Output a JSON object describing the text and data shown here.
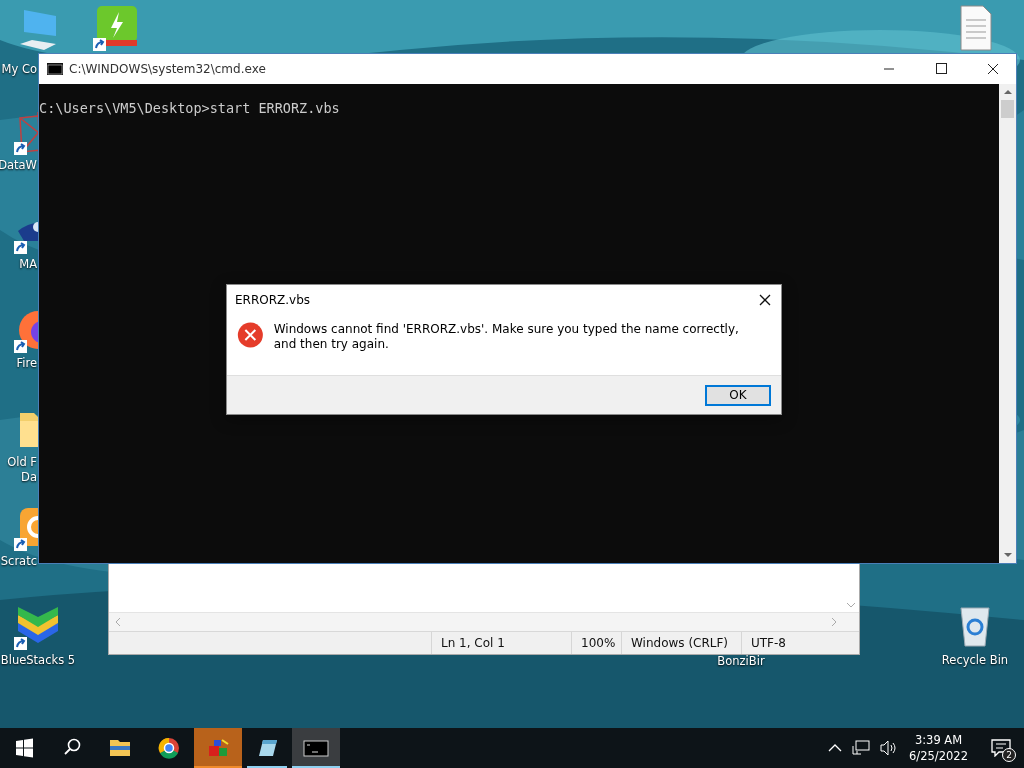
{
  "desktop_icons": [
    {
      "kind": "computer",
      "lines": [
        "My Co"
      ],
      "shortcut": false
    },
    {
      "kind": "green-app",
      "shortcut": true
    },
    {
      "kind": "network",
      "lines": [
        "DataW"
      ],
      "shortcut": true
    },
    {
      "kind": "ship",
      "lines": [
        "MA"
      ],
      "shortcut": true
    },
    {
      "kind": "firefox",
      "lines": [
        "Fire"
      ],
      "shortcut": true
    },
    {
      "kind": "folder",
      "lines": [
        "Old F",
        "Da"
      ],
      "shortcut": false
    },
    {
      "kind": "scratch",
      "lines": [
        "Scratc"
      ],
      "shortcut": true
    },
    {
      "kind": "bluestacks",
      "lines": [
        "BlueStacks 5"
      ],
      "shortcut": true
    },
    {
      "kind": "document",
      "shortcut": false
    },
    {
      "kind": "label-only",
      "lines": [
        "BonziBir"
      ]
    },
    {
      "kind": "recycle",
      "lines": [
        "Recycle Bin"
      ],
      "shortcut": false
    }
  ],
  "notepad": {
    "status": [
      "Ln 1, Col 1",
      "100%",
      "Windows (CRLF)",
      "UTF-8"
    ]
  },
  "cmd": {
    "title": "C:\\WINDOWS\\system32\\cmd.exe",
    "lines": [
      "C:\\Users\\VM5\\Desktop>start ERRORZ.vbs"
    ]
  },
  "dialog": {
    "title": "ERRORZ.vbs",
    "message": "Windows cannot find 'ERRORZ.vbs'. Make sure you typed the name correctly, and then try again.",
    "buttons": [
      "OK"
    ]
  },
  "taskbar": {
    "apps": [
      {
        "kind": "explorer",
        "running": false,
        "selected": false,
        "attention": false
      },
      {
        "kind": "chrome",
        "running": false,
        "selected": false,
        "attention": false
      },
      {
        "kind": "cubes",
        "running": true,
        "selected": false,
        "attention": true
      },
      {
        "kind": "notepad",
        "running": true,
        "selected": false,
        "attention": false
      },
      {
        "kind": "cmd",
        "running": true,
        "selected": true,
        "attention": false
      }
    ],
    "time": "3:39 AM",
    "date": "6/25/2022",
    "notifications": "2"
  }
}
